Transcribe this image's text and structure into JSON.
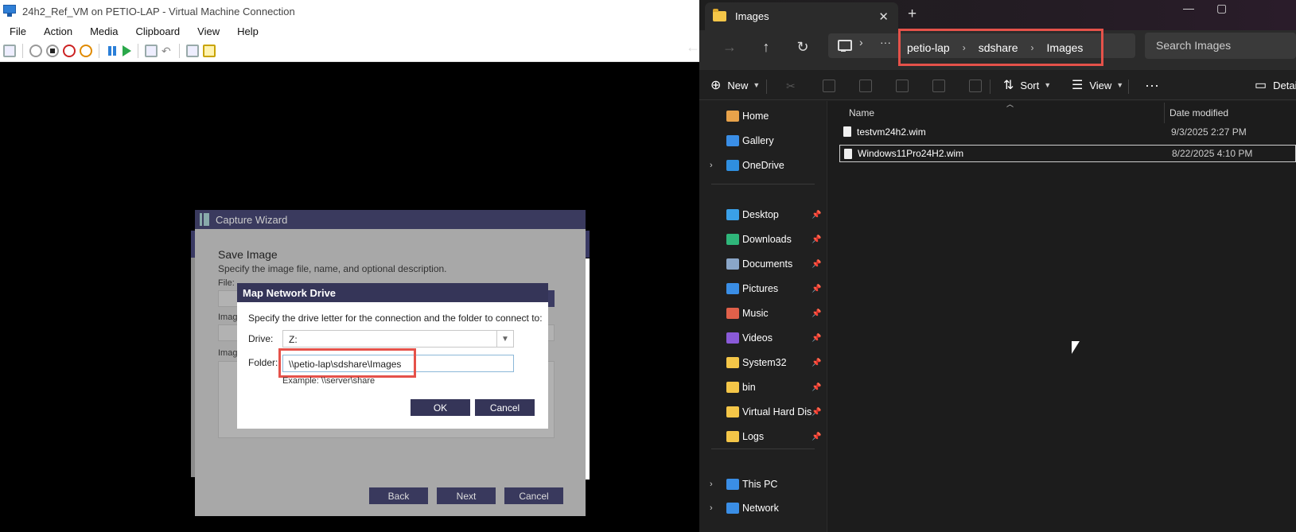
{
  "vm": {
    "title": "24h2_Ref_VM on PETIO-LAP - Virtual Machine Connection",
    "menu": [
      "File",
      "Action",
      "Media",
      "Clipboard",
      "View",
      "Help"
    ],
    "toolbar_icons": [
      "ctrl-alt-del-icon",
      "start-icon",
      "turn-off-icon",
      "shutdown-icon",
      "save-icon",
      "pause-icon",
      "resume-icon",
      "checkpoint-icon",
      "revert-icon",
      "enhanced-session-icon",
      "share-icon"
    ]
  },
  "wizard": {
    "title": "Capture Wizard",
    "heading": "Save Image",
    "description": "Specify the image file, name, and optional description.",
    "file_label": "File:",
    "image_name_label": "Imag",
    "image_desc_label": "Imag",
    "buttons": {
      "back": "Back",
      "next": "Next",
      "cancel": "Cancel"
    }
  },
  "map_drive": {
    "title": "Map Network Drive",
    "description": "Specify the drive letter for the connection and the folder to connect to:",
    "drive_label": "Drive:",
    "drive_value": "Z:",
    "folder_label": "Folder:",
    "folder_value": "\\\\petio-lap\\sdshare\\Images",
    "example": "Example: \\\\server\\share",
    "ok": "OK",
    "cancel": "Cancel",
    "highlight_color": "#e5524a"
  },
  "explorer": {
    "tab_title": "Images",
    "breadcrumb": [
      "petio-lap",
      "sdshare",
      "Images"
    ],
    "search_placeholder": "Search Images",
    "commands": {
      "new": "New",
      "sort": "Sort",
      "view": "View",
      "details": "Details"
    },
    "nav": [
      {
        "label": "Home",
        "icon": "home-icon",
        "color": "#e8a24a",
        "pinned": false,
        "expandable": false
      },
      {
        "label": "Gallery",
        "icon": "gallery-icon",
        "color": "#3a8ee6",
        "pinned": false,
        "expandable": false
      },
      {
        "label": "OneDrive",
        "icon": "onedrive-icon",
        "color": "#2f8fe0",
        "pinned": false,
        "expandable": true
      },
      {
        "label": "Desktop",
        "icon": "desktop-icon",
        "color": "#3aa0e8",
        "pinned": true,
        "expandable": false
      },
      {
        "label": "Downloads",
        "icon": "downloads-icon",
        "color": "#2fb67a",
        "pinned": true,
        "expandable": false
      },
      {
        "label": "Documents",
        "icon": "documents-icon",
        "color": "#8aa6c8",
        "pinned": true,
        "expandable": false
      },
      {
        "label": "Pictures",
        "icon": "pictures-icon",
        "color": "#3a8ee6",
        "pinned": true,
        "expandable": false
      },
      {
        "label": "Music",
        "icon": "music-icon",
        "color": "#e0604a",
        "pinned": true,
        "expandable": false
      },
      {
        "label": "Videos",
        "icon": "videos-icon",
        "color": "#8a5ad8",
        "pinned": true,
        "expandable": false
      },
      {
        "label": "System32",
        "icon": "folder-icon",
        "color": "#f4c648",
        "pinned": true,
        "expandable": false
      },
      {
        "label": "bin",
        "icon": "folder-icon",
        "color": "#f4c648",
        "pinned": true,
        "expandable": false
      },
      {
        "label": "Virtual Hard Disks",
        "icon": "folder-icon",
        "color": "#f4c648",
        "pinned": true,
        "expandable": false
      },
      {
        "label": "Logs",
        "icon": "folder-icon",
        "color": "#f4c648",
        "pinned": true,
        "expandable": false
      },
      {
        "label": "This PC",
        "icon": "this-pc-icon",
        "color": "#3a8ee6",
        "pinned": false,
        "expandable": true
      },
      {
        "label": "Network",
        "icon": "network-icon",
        "color": "#3a8ee6",
        "pinned": false,
        "expandable": true
      }
    ],
    "columns": {
      "name": "Name",
      "date": "Date modified"
    },
    "files": [
      {
        "name": "testvm24h2.wim",
        "date": "9/3/2025 2:27 PM",
        "selected": false
      },
      {
        "name": "Windows11Pro24H2.wim",
        "date": "8/22/2025 4:10 PM",
        "selected": true
      }
    ]
  }
}
